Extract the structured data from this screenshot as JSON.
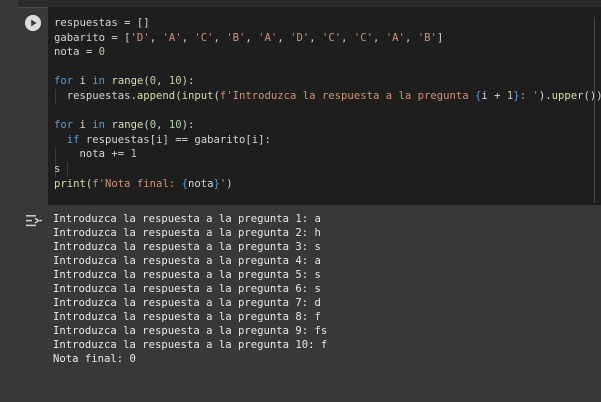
{
  "code_lines": [
    [
      {
        "t": "respuestas = []",
        "c": ""
      }
    ],
    [
      {
        "t": "gabarito = [",
        "c": ""
      },
      {
        "t": "'D'",
        "c": "str"
      },
      {
        "t": ", ",
        "c": ""
      },
      {
        "t": "'A'",
        "c": "str"
      },
      {
        "t": ", ",
        "c": ""
      },
      {
        "t": "'C'",
        "c": "str"
      },
      {
        "t": ", ",
        "c": ""
      },
      {
        "t": "'B'",
        "c": "str"
      },
      {
        "t": ", ",
        "c": ""
      },
      {
        "t": "'A'",
        "c": "str"
      },
      {
        "t": ", ",
        "c": ""
      },
      {
        "t": "'D'",
        "c": "str"
      },
      {
        "t": ", ",
        "c": ""
      },
      {
        "t": "'C'",
        "c": "str"
      },
      {
        "t": ", ",
        "c": ""
      },
      {
        "t": "'C'",
        "c": "str"
      },
      {
        "t": ", ",
        "c": ""
      },
      {
        "t": "'A'",
        "c": "str"
      },
      {
        "t": ", ",
        "c": ""
      },
      {
        "t": "'B'",
        "c": "str"
      },
      {
        "t": "]",
        "c": ""
      }
    ],
    [
      {
        "t": "nota = ",
        "c": ""
      },
      {
        "t": "0",
        "c": "num"
      }
    ],
    [],
    [
      {
        "t": "for",
        "c": "kw"
      },
      {
        "t": " i ",
        "c": ""
      },
      {
        "t": "in",
        "c": "kw"
      },
      {
        "t": " ",
        "c": ""
      },
      {
        "t": "range",
        "c": "fn"
      },
      {
        "t": "(",
        "c": ""
      },
      {
        "t": "0",
        "c": "num"
      },
      {
        "t": ", ",
        "c": ""
      },
      {
        "t": "10",
        "c": "num"
      },
      {
        "t": "):",
        "c": ""
      }
    ],
    [
      {
        "t": "  respuestas.",
        "c": ""
      },
      {
        "t": "append",
        "c": "fn"
      },
      {
        "t": "(",
        "c": ""
      },
      {
        "t": "input",
        "c": "fn"
      },
      {
        "t": "(",
        "c": ""
      },
      {
        "t": "f'Introduzca la respuesta a la pregunta ",
        "c": "str"
      },
      {
        "t": "{",
        "c": "kw"
      },
      {
        "t": "i + ",
        "c": ""
      },
      {
        "t": "1",
        "c": "num"
      },
      {
        "t": "}",
        "c": "kw"
      },
      {
        "t": ": '",
        "c": "str"
      },
      {
        "t": ").",
        "c": ""
      },
      {
        "t": "upper",
        "c": "fn"
      },
      {
        "t": "())",
        "c": ""
      }
    ],
    [],
    [
      {
        "t": "for",
        "c": "kw"
      },
      {
        "t": " i ",
        "c": ""
      },
      {
        "t": "in",
        "c": "kw"
      },
      {
        "t": " ",
        "c": ""
      },
      {
        "t": "range",
        "c": "fn"
      },
      {
        "t": "(",
        "c": ""
      },
      {
        "t": "0",
        "c": "num"
      },
      {
        "t": ", ",
        "c": ""
      },
      {
        "t": "10",
        "c": "num"
      },
      {
        "t": "):",
        "c": ""
      }
    ],
    [
      {
        "t": "  ",
        "c": ""
      },
      {
        "t": "if",
        "c": "kw"
      },
      {
        "t": " respuestas[i] == gabarito[i]:",
        "c": ""
      }
    ],
    [
      {
        "t": "    nota += ",
        "c": ""
      },
      {
        "t": "1",
        "c": "num"
      }
    ],
    [
      {
        "t": "s",
        "c": ""
      }
    ],
    [
      {
        "t": "print",
        "c": "fn"
      },
      {
        "t": "(",
        "c": ""
      },
      {
        "t": "f'Nota final: ",
        "c": "str"
      },
      {
        "t": "{",
        "c": "kw"
      },
      {
        "t": "nota",
        "c": ""
      },
      {
        "t": "}",
        "c": "kw"
      },
      {
        "t": "'",
        "c": "str"
      },
      {
        "t": ")",
        "c": ""
      }
    ]
  ],
  "output_lines": [
    "Introduzca la respuesta a la pregunta 1: a",
    "Introduzca la respuesta a la pregunta 2: h",
    "Introduzca la respuesta a la pregunta 3: s",
    "Introduzca la respuesta a la pregunta 4: a",
    "Introduzca la respuesta a la pregunta 5: s",
    "Introduzca la respuesta a la pregunta 6: s",
    "Introduzca la respuesta a la pregunta 7: d",
    "Introduzca la respuesta a la pregunta 8: f",
    "Introduzca la respuesta a la pregunta 9: fs",
    "Introduzca la respuesta a la pregunta 10: f",
    "Nota final: 0"
  ],
  "icons": {
    "run": "play-icon",
    "output": "output-menu-icon"
  },
  "colors": {
    "editor_bg": "#1e1e1e",
    "page_bg": "#383838",
    "keyword": "#569cd6",
    "function": "#dcdcaa",
    "string": "#ce9178",
    "number": "#b5cea8"
  }
}
